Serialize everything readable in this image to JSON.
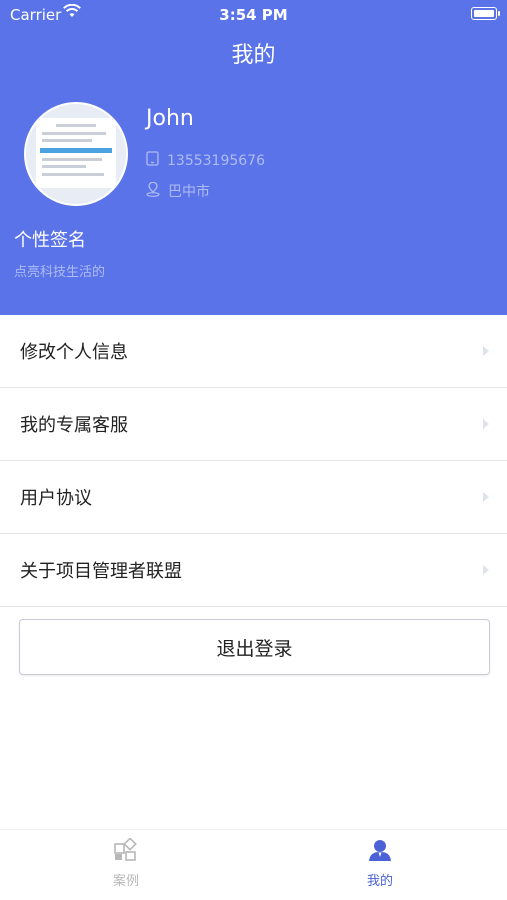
{
  "status_bar": {
    "carrier": "Carrier",
    "time": "3:54 PM"
  },
  "header": {
    "title": "我的"
  },
  "profile": {
    "name": "John",
    "phone": "13553195676",
    "location": "巴中市",
    "signature_title": "个性签名",
    "signature": "点亮科技生活的"
  },
  "menu": {
    "items": [
      {
        "label": "修改个人信息"
      },
      {
        "label": "我的专属客服"
      },
      {
        "label": "用户协议"
      },
      {
        "label": "关于项目管理者联盟"
      }
    ]
  },
  "logout_label": "退出登录",
  "tabs": [
    {
      "label": "案例",
      "icon": "cases-icon",
      "active": false
    },
    {
      "label": "我的",
      "icon": "profile-icon",
      "active": true
    }
  ],
  "colors": {
    "primary": "#5a73e8",
    "tab_active": "#4a62d6",
    "tab_inactive": "#b8b8b8"
  }
}
